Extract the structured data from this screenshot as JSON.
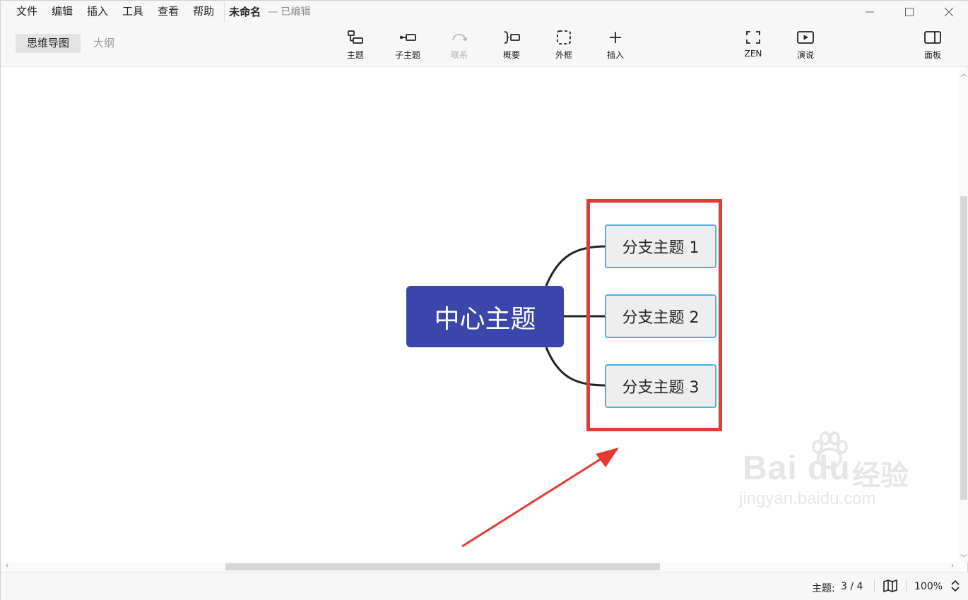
{
  "menubar": {
    "items": [
      "文件",
      "编辑",
      "插入",
      "工具",
      "查看",
      "帮助"
    ],
    "doc_title": "未命名",
    "doc_status": "— 已编辑"
  },
  "window_controls": {
    "minimize": "—",
    "maximize": "☐",
    "close": "✕"
  },
  "toolbar": {
    "view_tabs": [
      {
        "label": "思维导图",
        "active": true
      },
      {
        "label": "大纲",
        "active": false
      }
    ],
    "tools": [
      {
        "label": "主题",
        "icon": "topic-icon",
        "enabled": true
      },
      {
        "label": "子主题",
        "icon": "subtopic-icon",
        "enabled": true
      },
      {
        "label": "联系",
        "icon": "relationship-icon",
        "enabled": false
      },
      {
        "label": "概要",
        "icon": "summary-icon",
        "enabled": true
      },
      {
        "label": "外框",
        "icon": "boundary-icon",
        "enabled": true
      },
      {
        "label": "插入",
        "icon": "plus-icon",
        "enabled": true
      },
      {
        "label": "ZEN",
        "icon": "fullscreen-icon",
        "enabled": true
      },
      {
        "label": "演说",
        "icon": "present-icon",
        "enabled": true
      },
      {
        "label": "面板",
        "icon": "panel-icon",
        "enabled": true
      }
    ]
  },
  "mindmap": {
    "central_topic": "中心主题",
    "branches": [
      "分支主题 1",
      "分支主题 2",
      "分支主题 3"
    ],
    "colors": {
      "central_fill": "#3a46aa",
      "branch_border": "#3db5e6",
      "branch_fill": "#eeeeee",
      "connector": "#222222",
      "annotation": "#e53935"
    }
  },
  "watermark": {
    "brand": "Bai du",
    "cn": "经验",
    "url": "jingyan.baidu.com"
  },
  "statusbar": {
    "topic_count_label": "主题:",
    "topic_count_value": "3 / 4",
    "zoom": "100%"
  }
}
